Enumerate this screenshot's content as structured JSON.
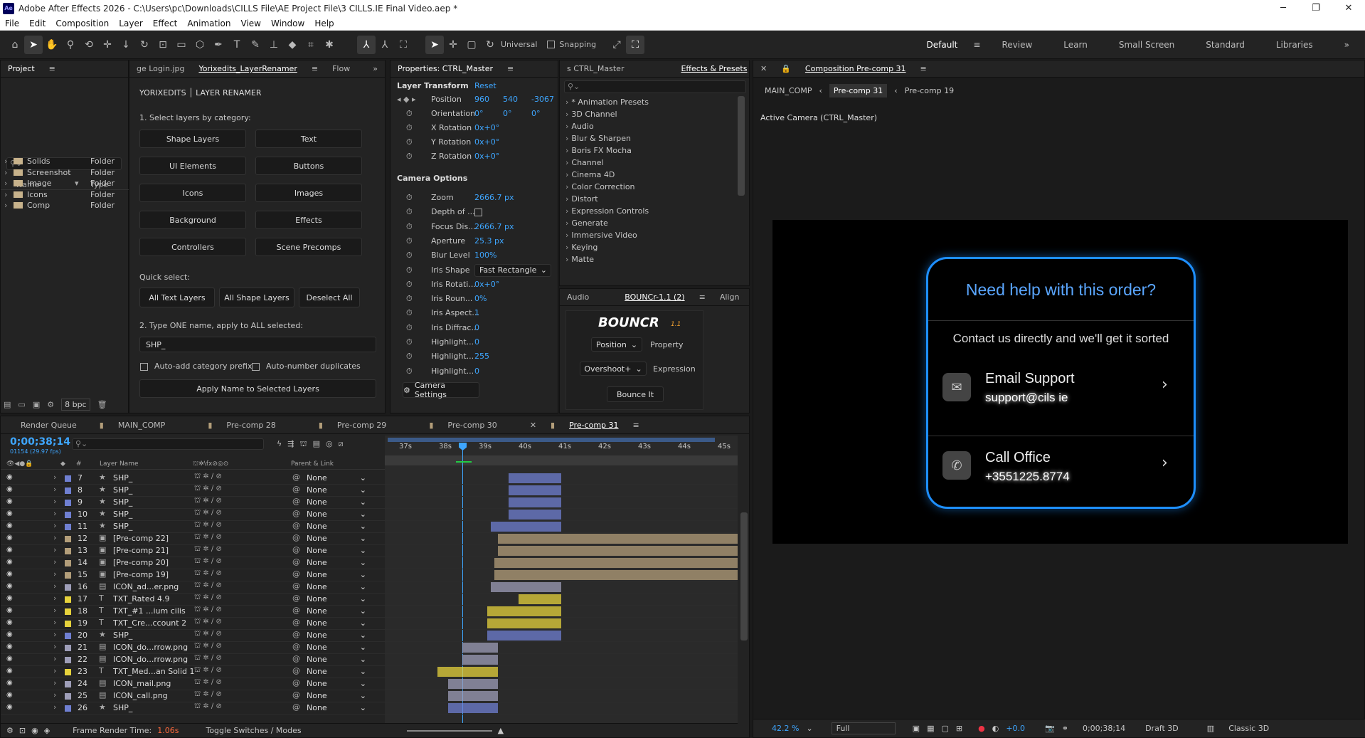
{
  "app": {
    "title": "Adobe After Effects 2026 - C:\\Users\\pc\\Downloads\\CILLS File\\AE Project File\\3 CILLS.IE Final Video.aep *",
    "logo": "Ae"
  },
  "menu": [
    "File",
    "Edit",
    "Composition",
    "Layer",
    "Effect",
    "Animation",
    "View",
    "Window",
    "Help"
  ],
  "toolbar": {
    "universal": "Universal",
    "snapping": "Snapping"
  },
  "workspaces": [
    "Default",
    "Review",
    "Learn",
    "Small Screen",
    "Standard",
    "Libraries"
  ],
  "project": {
    "tab": "Project",
    "col_name": "Name",
    "col_type": "Type",
    "items": [
      {
        "name": "Solids",
        "type": "Folder"
      },
      {
        "name": "Screenshot",
        "type": "Folder"
      },
      {
        "name": "Image",
        "type": "Folder"
      },
      {
        "name": "Icons",
        "type": "Folder"
      },
      {
        "name": "Comp",
        "type": "Folder"
      }
    ],
    "bpc": "8 bpc"
  },
  "renamer": {
    "tabs": [
      "ge Login.jpg",
      "Yorixedits_LayerRenamer",
      "Flow"
    ],
    "header": "YORIXEDITS │ LAYER RENAMER",
    "step1": "1. Select layers by category:",
    "buttons": [
      "Shape Layers",
      "Text",
      "UI Elements",
      "Buttons",
      "Icons",
      "Images",
      "Background",
      "Effects",
      "Controllers",
      "Scene Precomps"
    ],
    "quick_select": "Quick select:",
    "quick": [
      "All Text Layers",
      "All Shape Layers",
      "Deselect All"
    ],
    "step2": "2. Type ONE name, apply to ALL selected:",
    "name_value": "SHP_",
    "auto_prefix": "Auto-add category prefix",
    "auto_number": "Auto-number duplicates",
    "apply": "Apply Name to Selected Layers"
  },
  "properties": {
    "tab": "Properties: CTRL_Master",
    "layer_transform": "Layer Transform",
    "reset": "Reset",
    "position": {
      "label": "Position",
      "x": "960",
      "y": "540",
      "z": "-3067"
    },
    "orientation": {
      "label": "Orientation",
      "x": "0°",
      "y": "0°",
      "z": "0°"
    },
    "rotations": [
      {
        "label": "X Rotation",
        "value": "0x+0°"
      },
      {
        "label": "Y Rotation",
        "value": "0x+0°"
      },
      {
        "label": "Z Rotation",
        "value": "0x+0°"
      }
    ],
    "camera_options": "Camera Options",
    "camera": [
      {
        "label": "Zoom",
        "value": "2666.7 px"
      },
      {
        "label": "Depth of ...",
        "value": ""
      },
      {
        "label": "Focus Dis...",
        "value": "2666.7 px"
      },
      {
        "label": "Aperture",
        "value": "25.3 px"
      },
      {
        "label": "Blur Level",
        "value": "100%"
      },
      {
        "label": "Iris Shape",
        "value": "Fast Rectangle"
      },
      {
        "label": "Iris Rotati...",
        "value": "0x+0°"
      },
      {
        "label": "Iris Roun...",
        "value": "0%"
      },
      {
        "label": "Iris Aspect...",
        "value": "1"
      },
      {
        "label": "Iris Diffrac...",
        "value": "0"
      },
      {
        "label": "Highlight...",
        "value": "0"
      },
      {
        "label": "Highlight...",
        "value": "255"
      },
      {
        "label": "Highlight...",
        "value": "0"
      }
    ],
    "camera_settings": "Camera Settings"
  },
  "effects": {
    "tabs": [
      "s CTRL_Master",
      "Effects & Presets"
    ],
    "items": [
      "* Animation Presets",
      "3D Channel",
      "Audio",
      "Blur & Sharpen",
      "Boris FX Mocha",
      "Channel",
      "Cinema 4D",
      "Color Correction",
      "Distort",
      "Expression Controls",
      "Generate",
      "Immersive Video",
      "Keying",
      "Matte"
    ]
  },
  "bouncr": {
    "tabs": [
      "Audio",
      "BOUNCr-1.1 (2)",
      "Align"
    ],
    "logo": "BOUNCR",
    "version": "1.1",
    "property_select": "Position",
    "property": "Property",
    "expr_select": "Overshoot+",
    "expression": "Expression",
    "bounce": "Bounce It"
  },
  "comp_viewer": {
    "tab": "Composition Pre-comp 31",
    "breadcrumb": [
      "MAIN_COMP",
      "Pre-comp 31",
      "Pre-comp 19"
    ],
    "camera": "Active Camera (CTRL_Master)",
    "card": {
      "title": "Need help with this order?",
      "subtitle": "Contact us directly and we'll get it sorted",
      "rows": [
        {
          "title": "Email Support",
          "sub": "support@cils ie"
        },
        {
          "title": "Call Office",
          "sub": "+3551225.8774"
        }
      ]
    },
    "zoom": "42.2 %",
    "resolution": "Full",
    "exposure": "+0.0",
    "timecode": "0;00;38;14",
    "renderer": "Draft 3D",
    "view": "Classic 3D"
  },
  "timeline": {
    "tabs": [
      "Render Queue",
      "MAIN_COMP",
      "Pre-comp 28",
      "Pre-comp 29",
      "Pre-comp 30",
      "Pre-comp 31"
    ],
    "timecode": "0;00;38;14",
    "fps": "01154 (29.97 fps)",
    "col_layer": "Layer Name",
    "col_parent": "Parent & Link",
    "col_num": "#",
    "ruler": [
      "37s",
      "38s",
      "39s",
      "40s",
      "41s",
      "42s",
      "43s",
      "44s",
      "45s"
    ],
    "layers": [
      {
        "n": "7",
        "name": "SHP_",
        "label": "#6f7fd1",
        "bar": [
          0.35,
          0.5
        ]
      },
      {
        "n": "8",
        "name": "SHP_",
        "label": "#6f7fd1",
        "bar": [
          0.35,
          0.5
        ]
      },
      {
        "n": "9",
        "name": "SHP_",
        "label": "#6f7fd1",
        "bar": [
          0.35,
          0.5
        ]
      },
      {
        "n": "10",
        "name": "SHP_",
        "label": "#6f7fd1",
        "bar": [
          0.35,
          0.5
        ]
      },
      {
        "n": "11",
        "name": "SHP_",
        "label": "#6f7fd1",
        "bar": [
          0.3,
          0.5
        ]
      },
      {
        "n": "12",
        "name": "[Pre-comp 22]",
        "label": "#b39e7a",
        "bar": [
          0.32,
          1
        ]
      },
      {
        "n": "13",
        "name": "[Pre-comp 21]",
        "label": "#b39e7a",
        "bar": [
          0.32,
          1
        ]
      },
      {
        "n": "14",
        "name": "[Pre-comp 20]",
        "label": "#b39e7a",
        "bar": [
          0.31,
          1
        ]
      },
      {
        "n": "15",
        "name": "[Pre-comp 19]",
        "label": "#b39e7a",
        "bar": [
          0.31,
          1
        ]
      },
      {
        "n": "16",
        "name": "ICON_ad...er.png",
        "label": "#9e9eb8",
        "bar": [
          0.3,
          0.5
        ]
      },
      {
        "n": "17",
        "name": "TXT_Rated 4.9",
        "label": "#e6d23c",
        "bar": [
          0.38,
          0.5
        ]
      },
      {
        "n": "18",
        "name": "TXT_#1 ...ium cilis",
        "label": "#e6d23c",
        "bar": [
          0.29,
          0.5
        ]
      },
      {
        "n": "19",
        "name": "TXT_Cre...ccount 2",
        "label": "#e6d23c",
        "bar": [
          0.29,
          0.5
        ]
      },
      {
        "n": "20",
        "name": "SHP_",
        "label": "#6f7fd1",
        "bar": [
          0.29,
          0.5
        ]
      },
      {
        "n": "21",
        "name": "ICON_do...rrow.png",
        "label": "#9e9eb8",
        "bar": [
          0.22,
          0.32
        ]
      },
      {
        "n": "22",
        "name": "ICON_do...rrow.png",
        "label": "#9e9eb8",
        "bar": [
          0.22,
          0.32
        ]
      },
      {
        "n": "23",
        "name": "TXT_Med...an Solid 1",
        "label": "#e6d23c",
        "bar": [
          0.15,
          0.32
        ]
      },
      {
        "n": "24",
        "name": "ICON_mail.png",
        "label": "#9e9eb8",
        "bar": [
          0.18,
          0.32
        ]
      },
      {
        "n": "25",
        "name": "ICON_call.png",
        "label": "#9e9eb8",
        "bar": [
          0.18,
          0.32
        ]
      },
      {
        "n": "26",
        "name": "SHP_",
        "label": "#6f7fd1",
        "bar": [
          0.18,
          0.32
        ]
      }
    ],
    "parent": "None",
    "frame_render": "Frame Render Time:",
    "frame_time": "1.06s",
    "toggle": "Toggle Switches / Modes"
  },
  "colors": {
    "accent": "#3ea6ff",
    "card_border": "#1e8fff",
    "card_title": "#5aa6ff"
  }
}
